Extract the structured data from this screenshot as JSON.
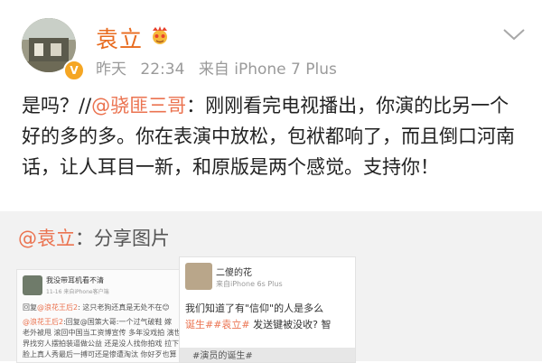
{
  "post": {
    "username": "袁立",
    "time": "昨天",
    "clock": "22:34",
    "source": "来自 iPhone 7 Plus",
    "lead": "是吗？//",
    "mention": "@骁匪三哥",
    "text": "：刚刚看完电视播出，你演的比另一个好的多的多。你在表演中放松，包袱都响了，而且倒口河南话，让人耳目一新，和原版是两个感觉。支持你！"
  },
  "retweet": {
    "mention": "@袁立",
    "text": "：分享图片",
    "thumb1": {
      "name": "我没带耳机看不清",
      "time": "11-16 来自iPhone客户端",
      "reply_prefix": "回复",
      "reply_mention": "@浪花王后2",
      "reply_text": ": 这只老狗还真是无处不在😊",
      "mention2": "@浪花王后2",
      "line2": ":回复@国策大哥:一个过气破鞋 嫁",
      "line3": "老外被甩 滚回中国当工资博宣传 多年没戏拍 演世",
      "line4": "界找穷人摆拍装逼做公益 还是没人找你拍戏 拉下",
      "line5": "脸上真人秀最后一搏可还是惨遭淘汰 你好歹也算"
    },
    "thumb2": {
      "name": "二傻的花",
      "meta": "来自iPhone 6s Plus",
      "line1": "我们知道了有\"信仰\"的人是多么",
      "line2_mention": "诞生##袁立#",
      "line2_text": " 发送键被没收? 智",
      "bottom": "#演员的诞生#"
    }
  }
}
